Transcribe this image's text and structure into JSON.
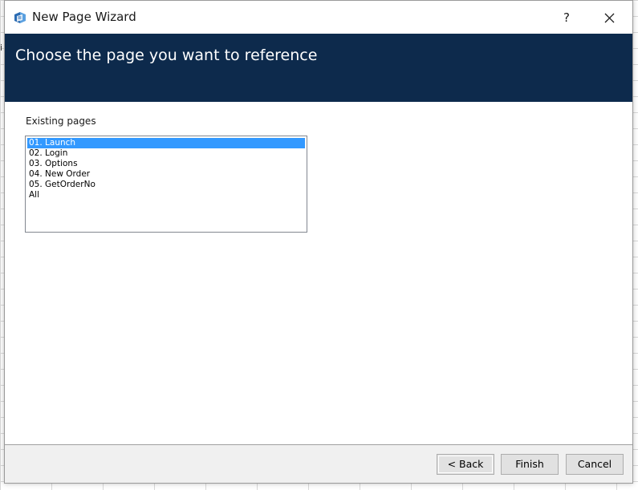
{
  "window": {
    "title": "New Page Wizard",
    "help_label": "?",
    "app_icon": "wizard-app-icon",
    "close_icon": "close-icon"
  },
  "header": {
    "title": "Choose the page you want to reference",
    "background_color": "#0d2a4c"
  },
  "background": {
    "glyph": "i"
  },
  "existing_pages": {
    "label": "Existing pages",
    "items": [
      {
        "label": "01. Launch",
        "selected": true
      },
      {
        "label": "02. Login",
        "selected": false
      },
      {
        "label": "03. Options",
        "selected": false
      },
      {
        "label": "04. New Order",
        "selected": false
      },
      {
        "label": "05. GetOrderNo",
        "selected": false
      },
      {
        "label": "All",
        "selected": false
      }
    ],
    "selection_color": "#3399ff"
  },
  "footer": {
    "back_label": "< Back",
    "finish_label": "Finish",
    "cancel_label": "Cancel"
  }
}
